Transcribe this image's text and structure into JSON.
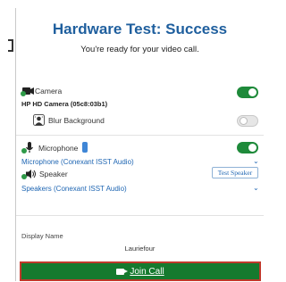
{
  "header": {
    "title": "Hardware Test: Success",
    "subtitle": "You're ready for your video call."
  },
  "camera": {
    "label": "Camera",
    "device": "HP HD Camera (05c8:03b1)",
    "enabled": true,
    "icon": "camera-icon"
  },
  "blur": {
    "label": "Blur Background",
    "enabled": false,
    "icon": "blur-background-icon"
  },
  "microphone": {
    "label": "Microphone",
    "enabled": true,
    "selected": "Microphone (Conexant ISST Audio)",
    "icon": "microphone-icon"
  },
  "speaker": {
    "label": "Speaker",
    "test_button": "Test Speaker",
    "selected": "Speakers (Conexant ISST Audio)",
    "icon": "speaker-icon"
  },
  "display": {
    "label": "Display Name",
    "value": "Lauriefour"
  },
  "join": {
    "label": "Join Call"
  },
  "colors": {
    "title": "#1f5f9e",
    "toggle_on": "#1e8a3a",
    "join_bg": "#157a2e",
    "join_border": "#c0392b",
    "link": "#1f66b3"
  }
}
